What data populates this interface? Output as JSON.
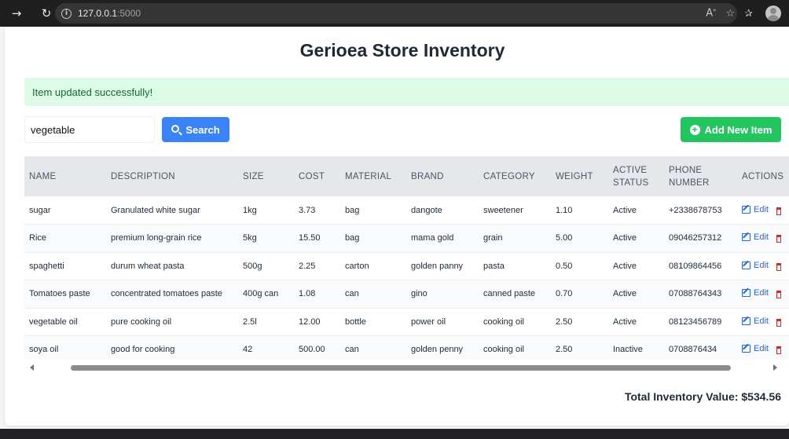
{
  "browser": {
    "url_host": "127.0.0.1",
    "url_port": ":5000"
  },
  "page": {
    "title": "Gerioea Store Inventory",
    "alert": "Item updated successfully!"
  },
  "search": {
    "value": "vegetable",
    "button_label": "Search"
  },
  "add_button_label": "Add New Item",
  "table": {
    "columns": [
      "NAME",
      "DESCRIPTION",
      "SIZE",
      "COST",
      "MATERIAL",
      "BRAND",
      "CATEGORY",
      "WEIGHT",
      "ACTIVE STATUS",
      "PHONE NUMBER",
      "ACTIONS"
    ],
    "edit_label": "Edit",
    "rows": [
      [
        "sugar",
        "Granulated white sugar",
        "1kg",
        "3.73",
        "bag",
        "dangote",
        "sweetener",
        "1.10",
        "Active",
        "+2338678753"
      ],
      [
        "Rice",
        "premium long-grain rice",
        "5kg",
        "15.50",
        "bag",
        "mama gold",
        "grain",
        "5.00",
        "Active",
        "09046257312"
      ],
      [
        "spaghetti",
        "durum wheat pasta",
        "500g",
        "2.25",
        "carton",
        "golden panny",
        "pasta",
        "0.50",
        "Active",
        "08109864456"
      ],
      [
        "Tomatoes paste",
        "concentrated tomatoes paste",
        "400g can",
        "1.08",
        "can",
        "gino",
        "canned paste",
        "0.70",
        "Active",
        "07088764343"
      ],
      [
        "vegetable oil",
        "pure cooking oil",
        "2.5l",
        "12.00",
        "bottle",
        "power oil",
        "cooking oil",
        "2.50",
        "Active",
        "08123456789"
      ],
      [
        "soya oil",
        "good for cooking",
        "42",
        "500.00",
        "can",
        "golden penny",
        "cooking oil",
        "2.50",
        "Inactive",
        "0708876434"
      ]
    ]
  },
  "total": {
    "label": "Total Inventory Value:",
    "value": "$534.56"
  },
  "colors": {
    "primary_blue": "#3b82f6",
    "success_green": "#22c55e",
    "alert_bg": "#dcfce7",
    "alert_text": "#166534",
    "delete_red": "#dc2626"
  }
}
